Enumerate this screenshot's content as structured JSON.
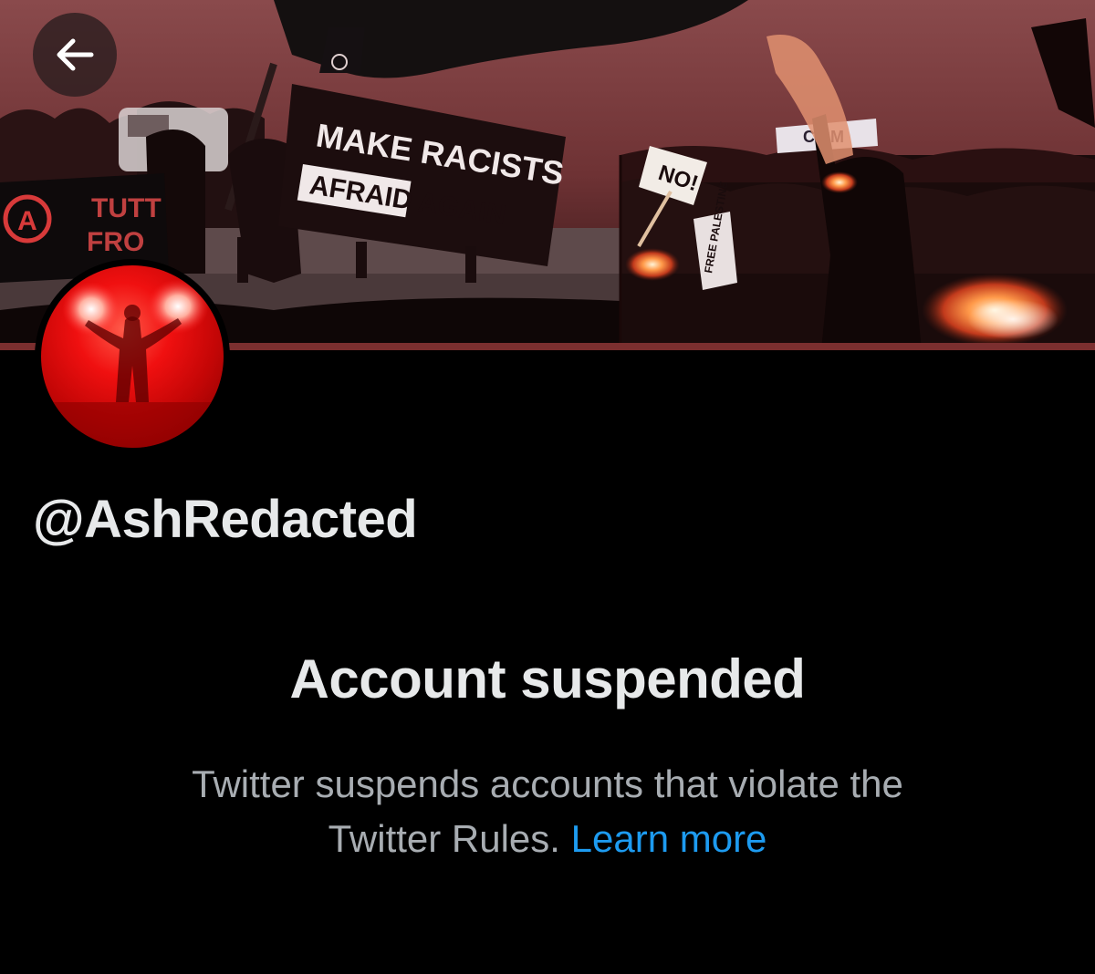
{
  "header": {
    "back_icon": "arrow-left-icon"
  },
  "banner": {
    "sign_line1": "MAKE RACISTS",
    "sign_line2": "AFRAID AGAIN",
    "left_banner_text1": "TUTT",
    "left_banner_text2": "FRO",
    "small_sign_text": "NO!",
    "top_sign_text": "CISM",
    "vertical_sign_text": "FREE PALESTINE",
    "accent_color": "#7b2f2f"
  },
  "profile": {
    "handle": "@AshRedacted",
    "avatar_color": "#e01010"
  },
  "suspension": {
    "title": "Account suspended",
    "body_text_line1": "Twitter suspends accounts that violate the",
    "body_text_line2": "Twitter Rules.",
    "learn_more_label": "Learn more",
    "link_color": "#1d9bf0"
  }
}
